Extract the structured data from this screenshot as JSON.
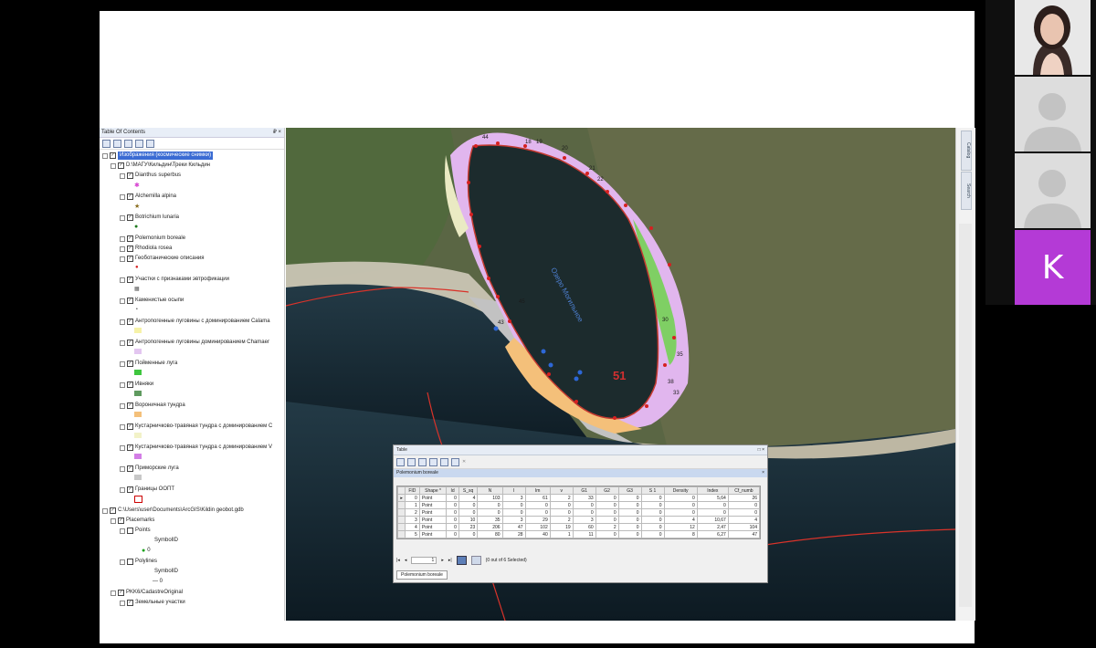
{
  "toc": {
    "title": "Table Of Contents",
    "pin_close": "₽ ×",
    "items": [
      {
        "label": "Изображения (космические снимки)",
        "selected": true
      },
      {
        "label": "D:\\МАГУ\\Кильдин\\Треки Кильдин"
      },
      {
        "label": "Dianthus superbus"
      },
      {
        "label": "Alchemilla alpina"
      },
      {
        "label": "Botrichium lunaria"
      },
      {
        "label": "Polemonium boreale"
      },
      {
        "label": "Rhodiola rosea"
      },
      {
        "label": "Геоботанические описания"
      },
      {
        "label": "Участки с признаками эвтрофикации"
      },
      {
        "label": "Каменистые осыпи"
      },
      {
        "label": "Антропогенные луговины с доминированием Calama"
      },
      {
        "label": "Антропогенные луговины доминированием Chamaer"
      },
      {
        "label": "Пойменные луга"
      },
      {
        "label": "Ивняки"
      },
      {
        "label": "Вороничная тундра"
      },
      {
        "label": "Кустарничково-травяная тундра с доминированием С"
      },
      {
        "label": "Кустарничково-травяная тундра с доминированием V"
      },
      {
        "label": "Приморские луга"
      },
      {
        "label": "Границы ООПТ"
      },
      {
        "label": "C:\\Users\\user\\Documents\\ArcGIS\\Kildin geobot.gdb"
      },
      {
        "label": "Placemarks"
      },
      {
        "label": "Points"
      },
      {
        "label": "SymbolID"
      },
      {
        "label": "0"
      },
      {
        "label": "Polylines"
      },
      {
        "label": "SymbolID"
      },
      {
        "label": "— 0"
      },
      {
        "label": "PKK6/CadastreOriginal"
      },
      {
        "label": "Земельные участки"
      }
    ]
  },
  "map": {
    "lake_label": "Озеро Могильное",
    "big_number": "51",
    "point_labels": [
      "44",
      "18",
      "19",
      "20",
      "21",
      "22",
      "45",
      "43",
      "30",
      "35",
      "38",
      "33"
    ]
  },
  "rightbar": {
    "tabs": [
      "Catalog",
      "Search"
    ]
  },
  "table": {
    "window_title": "Table",
    "layer_name": "Polemonium boreale",
    "columns": [
      "FID",
      "Shape *",
      "Id",
      "S_sq",
      "N",
      "I",
      "Im",
      "v",
      "G1",
      "G2",
      "G3",
      "S 1",
      "Density",
      "Index",
      "Cf_numb"
    ],
    "rows": [
      [
        "0",
        "Point",
        "0",
        "4",
        "103",
        "3",
        "61",
        "2",
        "33",
        "0",
        "0",
        "0",
        "0",
        "5,64",
        "26"
      ],
      [
        "1",
        "Point",
        "0",
        "0",
        "0",
        "0",
        "0",
        "0",
        "0",
        "0",
        "0",
        "0",
        "0",
        "0",
        "0"
      ],
      [
        "2",
        "Point",
        "0",
        "0",
        "0",
        "0",
        "0",
        "0",
        "0",
        "0",
        "0",
        "0",
        "0",
        "0",
        "0"
      ],
      [
        "3",
        "Point",
        "0",
        "10",
        "35",
        "3",
        "29",
        "2",
        "3",
        "0",
        "0",
        "0",
        "4",
        "10,67",
        "4"
      ],
      [
        "4",
        "Point",
        "0",
        "23",
        "206",
        "47",
        "102",
        "19",
        "60",
        "2",
        "0",
        "0",
        "12",
        "2,47",
        "104"
      ],
      [
        "5",
        "Point",
        "0",
        "0",
        "80",
        "28",
        "40",
        "1",
        "11",
        "0",
        "0",
        "0",
        "8",
        "6,27",
        "47"
      ]
    ],
    "record_value": "1",
    "selection_status": "(0 out of 6 Selected)",
    "bottom_tab": "Polemonium boreale"
  },
  "video": {
    "tile_letter": "K"
  },
  "colors": {
    "selection": "#3a6bd3",
    "lake": "#1c2b2d",
    "zone_pink": "#e3b6f0",
    "zone_orange": "#f4c07a",
    "border_red": "#c0392b",
    "participant_purple": "#b43ad6"
  }
}
